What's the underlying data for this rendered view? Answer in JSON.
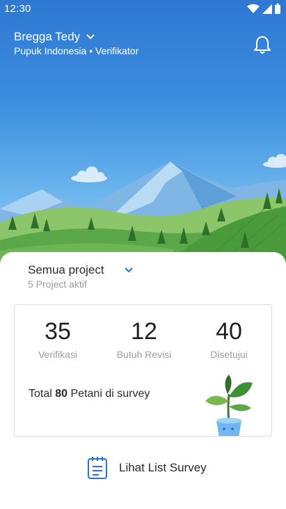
{
  "status_bar": {
    "time": "12:30",
    "icons": [
      "wifi-icon",
      "cell-signal-icon",
      "battery-icon"
    ]
  },
  "header": {
    "user_name": "Bregga Tedy",
    "user_subtitle": "Pupuk Indonesia • Verifikator",
    "icons": [
      "chevron-down-icon",
      "bell-icon"
    ]
  },
  "project": {
    "title": "Semua project",
    "subtitle": "5 Project aktif"
  },
  "stats": [
    {
      "value": "35",
      "label": "Verifikasi"
    },
    {
      "value": "12",
      "label": "Butuh Revisi"
    },
    {
      "value": "40",
      "label": "Disetujui"
    }
  ],
  "total": {
    "prefix": "Total",
    "count": "80",
    "suffix": "Petani di survey"
  },
  "actions": {
    "list_survey": "Lihat List Survey"
  },
  "colors": {
    "sky_top": "#2f78d2",
    "accent": "#2d6fd8",
    "grass": "#5ba84a"
  }
}
